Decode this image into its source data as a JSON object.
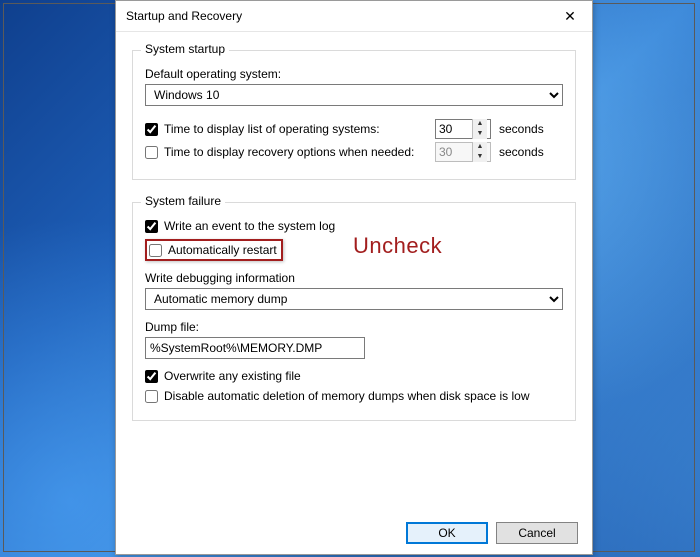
{
  "window": {
    "title": "Startup and Recovery"
  },
  "systemStartup": {
    "legend": "System startup",
    "defaultOsLabel": "Default operating system:",
    "defaultOsValue": "Windows 10",
    "timeListLabel": "Time to display list of operating systems:",
    "timeListChecked": true,
    "timeListValue": "30",
    "timeListUnit": "seconds",
    "timeRecoveryLabel": "Time to display recovery options when needed:",
    "timeRecoveryChecked": false,
    "timeRecoveryValue": "30",
    "timeRecoveryUnit": "seconds"
  },
  "systemFailure": {
    "legend": "System failure",
    "writeEventLabel": "Write an event to the system log",
    "writeEventChecked": true,
    "autoRestartLabel": "Automatically restart",
    "autoRestartChecked": false,
    "debugInfoLabel": "Write debugging information",
    "debugInfoValue": "Automatic memory dump",
    "dumpFileLabel": "Dump file:",
    "dumpFileValue": "%SystemRoot%\\MEMORY.DMP",
    "overwriteLabel": "Overwrite any existing file",
    "overwriteChecked": true,
    "disableDeleteLabel": "Disable automatic deletion of memory dumps when disk space is low",
    "disableDeleteChecked": false
  },
  "annotation": {
    "text": "Uncheck"
  },
  "buttons": {
    "ok": "OK",
    "cancel": "Cancel"
  }
}
